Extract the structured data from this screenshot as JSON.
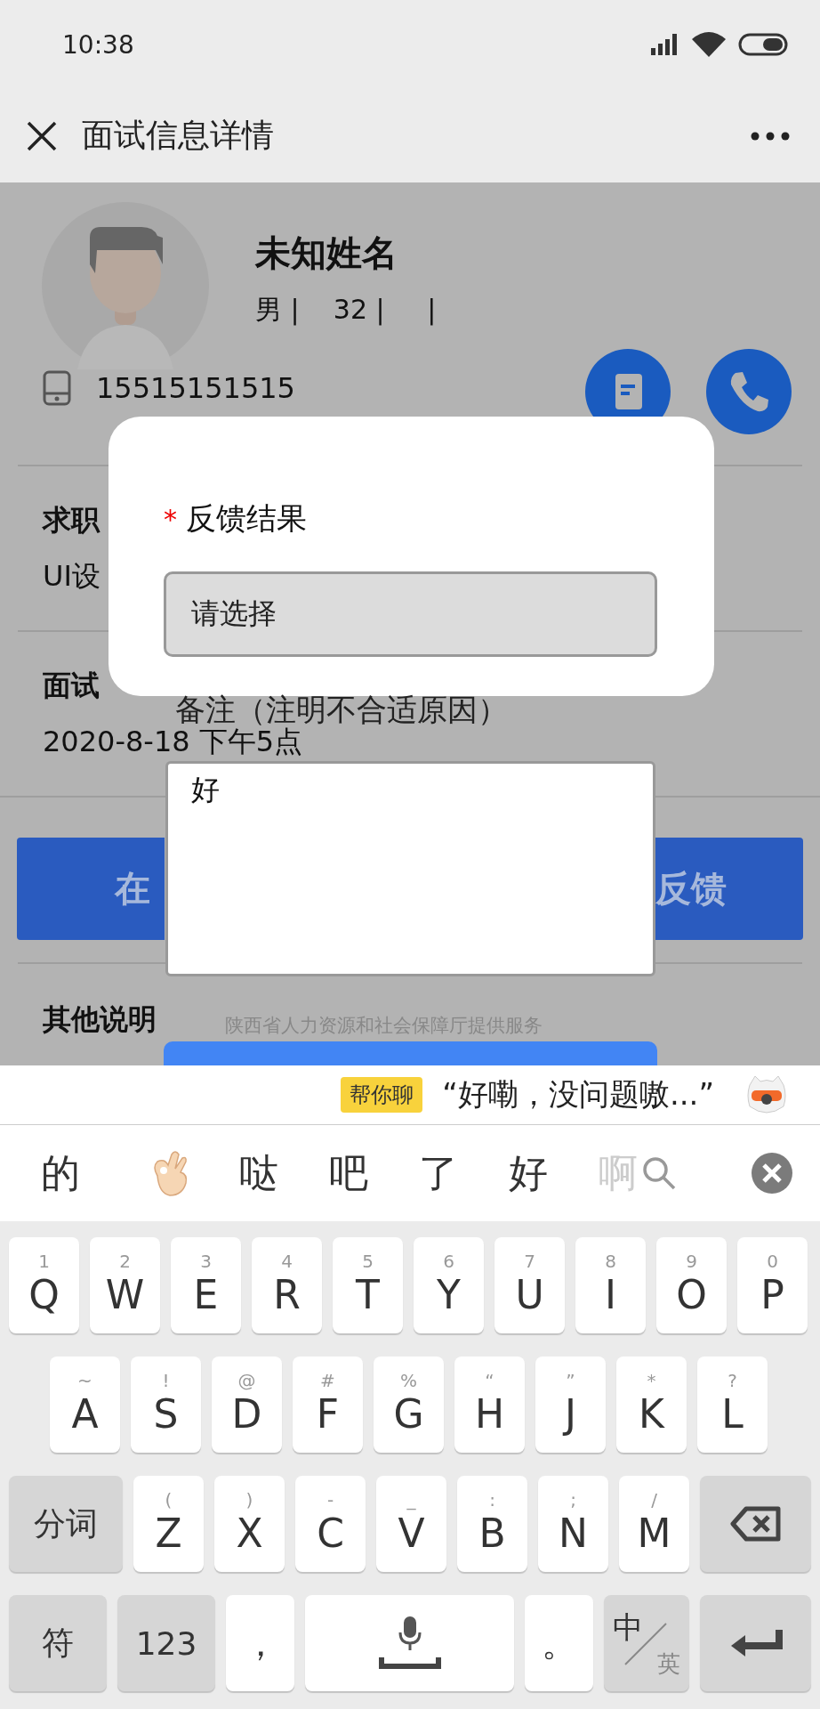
{
  "status_bar": {
    "time": "10:38"
  },
  "header": {
    "title": "面试信息详情"
  },
  "profile": {
    "name": "未知姓名",
    "details": "男 |    32 |     |",
    "phone": "15515151515"
  },
  "sections": [
    {
      "title": "求职",
      "value": "UI设"
    },
    {
      "title": "面试",
      "value": "2020-8-18 下午5点"
    }
  ],
  "action_button": {
    "left_text": "在",
    "right_text": "反馈"
  },
  "other_section": {
    "title": "其他说明"
  },
  "modal": {
    "required": true,
    "label": "反馈结果",
    "select": {
      "placeholder": "请选择"
    }
  },
  "notes": {
    "label": "备注（注明不合适原因）",
    "value": "好"
  },
  "footer": "陕西省人力资源和社会保障厅提供服务",
  "keyboard": {
    "badge": "帮你聊",
    "suggestion": "“好嘞，没问题嗷...”",
    "candidates": [
      {
        "kind": "text",
        "text": "的"
      },
      {
        "kind": "emoji"
      },
      {
        "kind": "text",
        "text": "哒"
      },
      {
        "kind": "text",
        "text": "吧"
      },
      {
        "kind": "text",
        "text": "了"
      },
      {
        "kind": "text",
        "text": "好"
      },
      {
        "kind": "faded",
        "text": "啊"
      }
    ],
    "key_rows": [
      {
        "keys": [
          {
            "kind": "letter",
            "label": "Q",
            "hint": "1"
          },
          {
            "kind": "letter",
            "label": "W",
            "hint": "2"
          },
          {
            "kind": "letter",
            "label": "E",
            "hint": "3"
          },
          {
            "kind": "letter",
            "label": "R",
            "hint": "4"
          },
          {
            "kind": "letter",
            "label": "T",
            "hint": "5"
          },
          {
            "kind": "letter",
            "label": "Y",
            "hint": "6"
          },
          {
            "kind": "letter",
            "label": "U",
            "hint": "7"
          },
          {
            "kind": "letter",
            "label": "I",
            "hint": "8"
          },
          {
            "kind": "letter",
            "label": "O",
            "hint": "9"
          },
          {
            "kind": "letter",
            "label": "P",
            "hint": "0"
          }
        ]
      },
      {
        "keys": [
          {
            "kind": "letter",
            "label": "A",
            "hint": "~"
          },
          {
            "kind": "letter",
            "label": "S",
            "hint": "!"
          },
          {
            "kind": "letter",
            "label": "D",
            "hint": "@"
          },
          {
            "kind": "letter",
            "label": "F",
            "hint": "#"
          },
          {
            "kind": "letter",
            "label": "G",
            "hint": "%"
          },
          {
            "kind": "letter",
            "label": "H",
            "hint": "“"
          },
          {
            "kind": "letter",
            "label": "J",
            "hint": "”"
          },
          {
            "kind": "letter",
            "label": "K",
            "hint": "*"
          },
          {
            "kind": "letter",
            "label": "L",
            "hint": "?"
          }
        ]
      },
      {
        "keys": [
          {
            "kind": "func",
            "label": "分词"
          },
          {
            "kind": "letter",
            "label": "Z",
            "hint": "("
          },
          {
            "kind": "letter",
            "label": "X",
            "hint": ")"
          },
          {
            "kind": "letter",
            "label": "C",
            "hint": "-"
          },
          {
            "kind": "letter",
            "label": "V",
            "hint": "_"
          },
          {
            "kind": "letter",
            "label": "B",
            "hint": ":"
          },
          {
            "kind": "letter",
            "label": "N",
            "hint": ";"
          },
          {
            "kind": "letter",
            "label": "M",
            "hint": "/"
          },
          {
            "kind": "delete"
          }
        ]
      },
      {
        "keys": [
          {
            "kind": "func",
            "label": "符"
          },
          {
            "kind": "func",
            "label": "123"
          },
          {
            "kind": "punct",
            "label": "，"
          },
          {
            "kind": "space"
          },
          {
            "kind": "punct",
            "label": "。"
          },
          {
            "kind": "lang",
            "label": "中",
            "sub": "英"
          },
          {
            "kind": "enter"
          }
        ]
      }
    ]
  }
}
